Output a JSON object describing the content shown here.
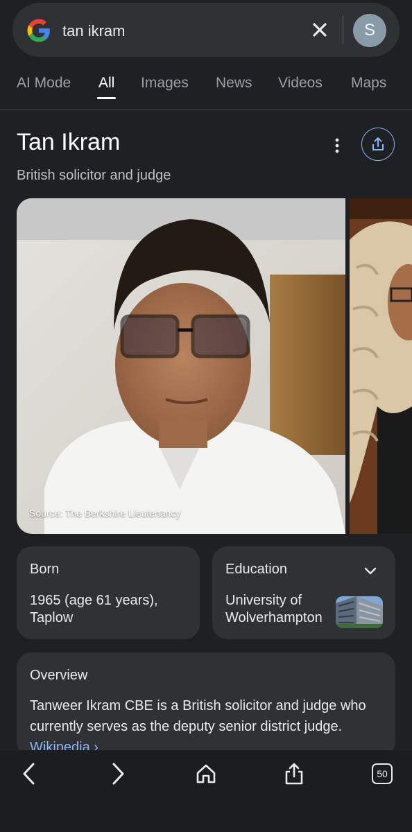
{
  "search": {
    "query": "tan ikram",
    "avatar_letter": "S"
  },
  "tabs": [
    {
      "label": "AI Mode"
    },
    {
      "label": "All"
    },
    {
      "label": "Images"
    },
    {
      "label": "News"
    },
    {
      "label": "Videos"
    },
    {
      "label": "Maps"
    }
  ],
  "active_tab": "All",
  "knowledge_panel": {
    "title": "Tan Ikram",
    "subtitle": "British solicitor and judge",
    "image_source": "Source: The Berkshire Lieutenancy",
    "born": {
      "label": "Born",
      "value": "1965 (age 61 years),\nTaplow"
    },
    "education": {
      "label": "Education",
      "value": "University of\nWolverhampton"
    },
    "overview": {
      "label": "Overview",
      "text": "Tanweer Ikram CBE is a British solicitor and judge who currently serves as the deputy senior district judge. ",
      "link": "Wikipedia ›"
    }
  },
  "bottom_bar": {
    "tab_count": "50"
  },
  "colors": {
    "background": "#1f2023",
    "surface": "#303134",
    "accent": "#8ab4f8"
  },
  "icons": [
    "google-logo-icon",
    "close-icon",
    "more-vert-icon",
    "share-icon",
    "chevron-down-icon",
    "back-icon",
    "forward-icon",
    "home-icon",
    "share-icon",
    "tabs-icon"
  ]
}
